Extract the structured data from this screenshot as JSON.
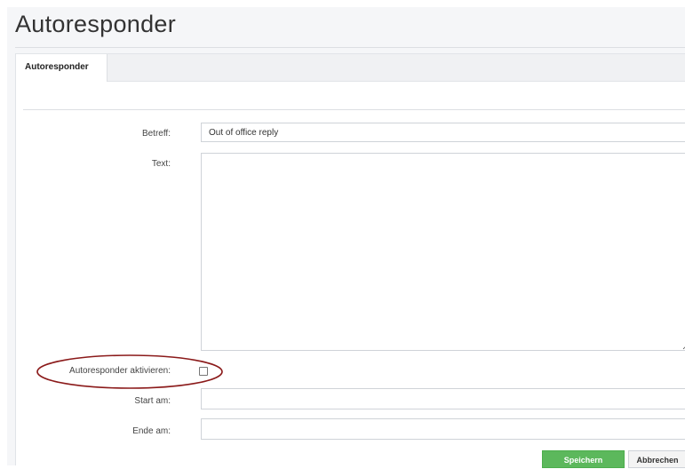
{
  "page": {
    "title": "Autoresponder"
  },
  "tabs": [
    {
      "label": "Autoresponder",
      "active": true
    }
  ],
  "form": {
    "subject": {
      "label": "Betreff:",
      "value": "Out of office reply"
    },
    "text": {
      "label": "Text:",
      "value": ""
    },
    "activate": {
      "label": "Autoresponder aktivieren:",
      "checked": false
    },
    "start": {
      "label": "Start am:",
      "value": ""
    },
    "end": {
      "label": "Ende am:",
      "value": ""
    }
  },
  "buttons": {
    "save_label": "Speichern",
    "cancel_label": "Abbrechen"
  },
  "colors": {
    "save_button": "#5cb85c",
    "annotation_ellipse": "#8b1a1a"
  }
}
